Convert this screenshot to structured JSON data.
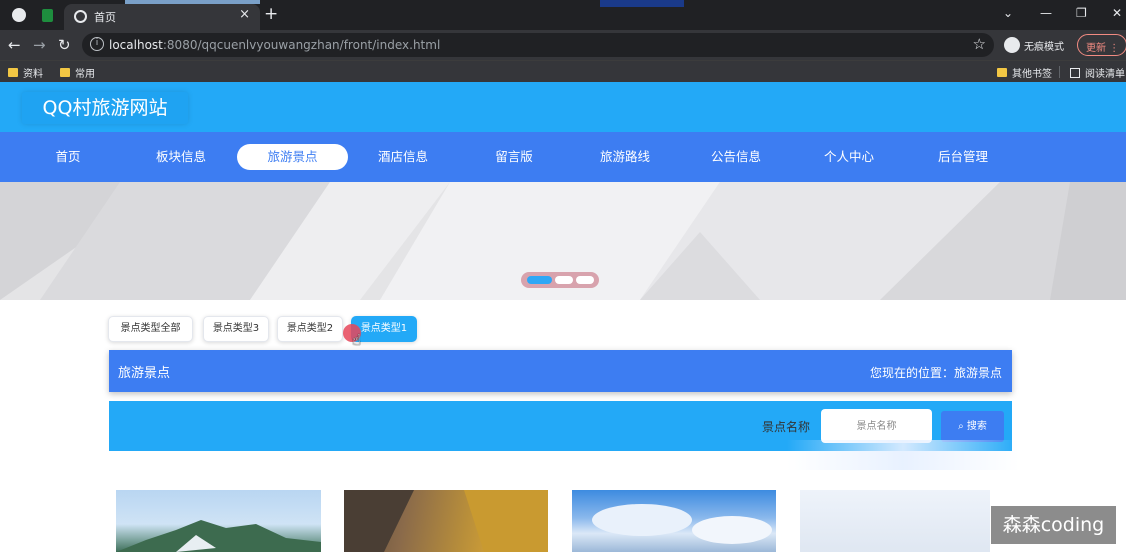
{
  "browser": {
    "tab_title": "首页",
    "tab_close": "×",
    "new_tab": "+",
    "url_host": "localhost",
    "url_rest": ":8080/qqcuenlvyouwangzhan/front/index.html",
    "incognito_label": "无痕模式",
    "update_label": "更新",
    "bookmarks": [
      "资料",
      "常用"
    ],
    "bookmarks_right": [
      "其他书签",
      "阅读清单"
    ]
  },
  "site": {
    "title": "QQ村旅游网站",
    "nav": [
      "首页",
      "板块信息",
      "旅游景点",
      "酒店信息",
      "留言版",
      "旅游路线",
      "公告信息",
      "个人中心",
      "后台管理"
    ],
    "nav_active_index": 2
  },
  "filters": {
    "items": [
      "景点类型全部",
      "景点类型3",
      "景点类型2",
      "景点类型1"
    ],
    "active_index": 3
  },
  "section": {
    "title": "旅游景点",
    "location": "您现在的位置：旅游景点"
  },
  "search": {
    "label": "景点名称",
    "placeholder": "景点名称",
    "button_label": "搜索"
  },
  "carousel": {
    "slides": 3,
    "active": 0
  },
  "watermark": "森森coding",
  "colors": {
    "header_blue": "#23a9f7",
    "nav_blue": "#3d7df2"
  }
}
